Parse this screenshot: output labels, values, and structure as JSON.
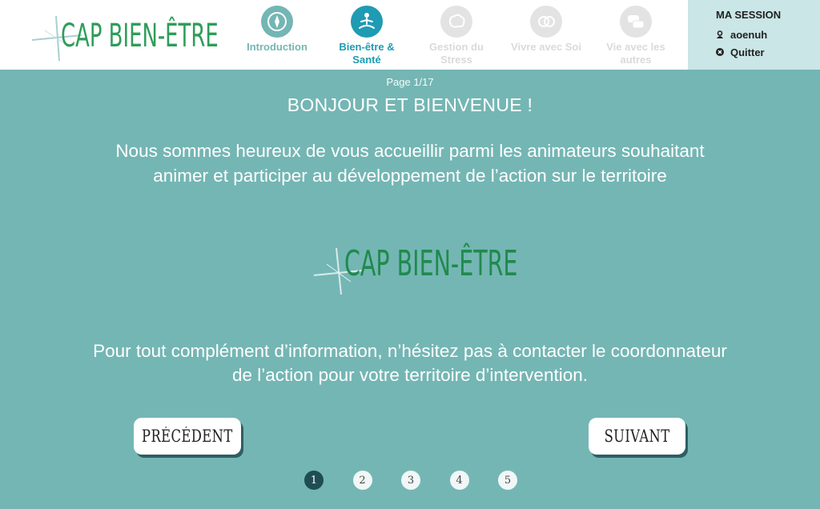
{
  "app": {
    "logo_text": "CAP BIEN-ÊTRE"
  },
  "nav": {
    "items": [
      {
        "label": "Introduction",
        "icon": "compass-icon",
        "state": "done"
      },
      {
        "label": "Bien-être & Santé",
        "icon": "meditation-icon",
        "state": "active"
      },
      {
        "label": "Gestion du Stress",
        "icon": "brain-icon",
        "state": "disabled"
      },
      {
        "label": "Vivre avec Soi",
        "icon": "faces-icon",
        "state": "disabled"
      },
      {
        "label": "Vie avec les autres",
        "icon": "speech-bubbles-icon",
        "state": "disabled"
      }
    ]
  },
  "session": {
    "title": "MA SESSION",
    "username": "aoenuh",
    "quit_label": "Quitter"
  },
  "content": {
    "page_counter": "Page 1/17",
    "heading": "BONJOUR ET BIENVENUE !",
    "intro": "Nous sommes heureux de vous accueillir parmi les animateurs souhaitant animer et participer au développement de l’action sur le territoire",
    "contact": "Pour tout complément d’information, n’hésitez pas à contacter le coordonnateur de l’action pour votre territoire d’intervention."
  },
  "navigation": {
    "prev_label": "PRÉCÉDENT",
    "next_label": "SUIVANT"
  },
  "pager": {
    "pages": [
      "1",
      "2",
      "3",
      "4",
      "5"
    ],
    "current": "1"
  },
  "colors": {
    "background": "#74b6b4",
    "brand_green": "#2e9d5a",
    "active_nav": "#1f9bb3",
    "session_bg": "#cbe6e6",
    "pager_current": "#1e4d52"
  }
}
